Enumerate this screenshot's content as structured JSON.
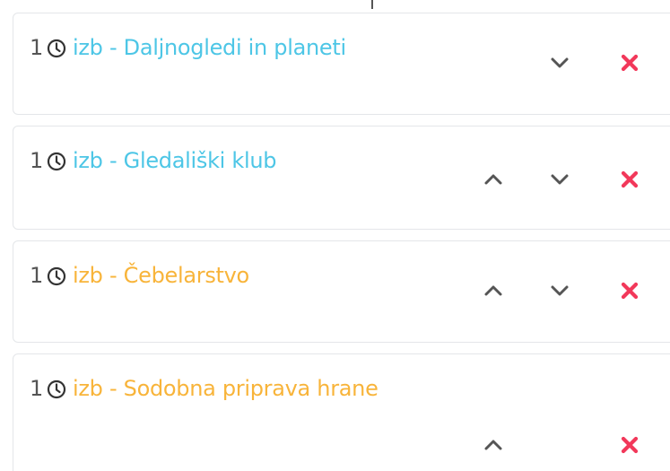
{
  "colors": {
    "blue": "#4dc6e6",
    "orange": "#f8b43a",
    "red": "#f2385a",
    "chevron": "#555555"
  },
  "items": [
    {
      "quantity": "1",
      "prefix": "izb",
      "separator": "-",
      "name": "Daljnogledi in planeti",
      "color": "blue",
      "has_up": false,
      "has_down": true,
      "has_remove": true
    },
    {
      "quantity": "1",
      "prefix": "izb",
      "separator": "-",
      "name": "Gledališki klub",
      "color": "blue",
      "has_up": true,
      "has_down": true,
      "has_remove": true
    },
    {
      "quantity": "1",
      "prefix": "izb",
      "separator": "-",
      "name": "Čebelarstvo",
      "color": "orange",
      "has_up": true,
      "has_down": true,
      "has_remove": true
    },
    {
      "quantity": "1",
      "prefix": "izb",
      "separator": "-",
      "name": "Sodobna priprava hrane",
      "color": "orange",
      "has_up": true,
      "has_down": false,
      "has_remove": true
    }
  ]
}
